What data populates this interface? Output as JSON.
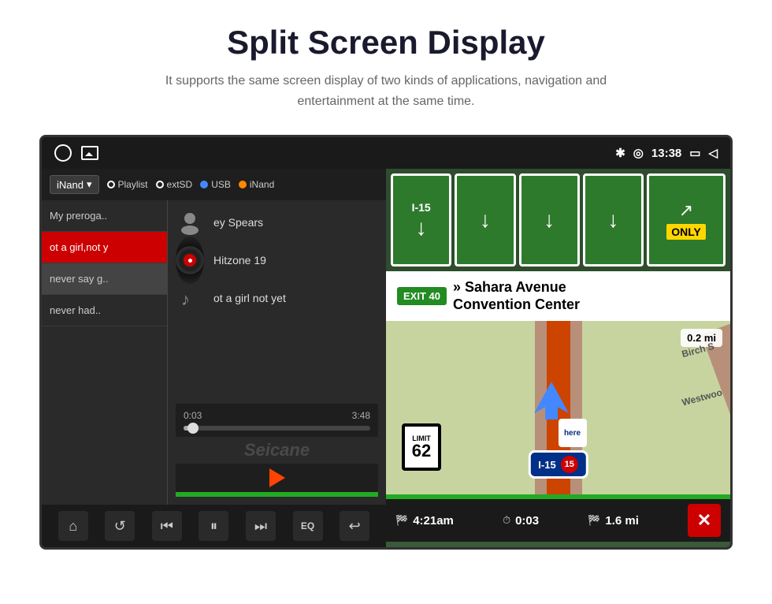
{
  "page": {
    "title": "Split Screen Display",
    "subtitle": "It supports the same screen display of two kinds of applications,\nnavigation and entertainment at the same time."
  },
  "status_bar": {
    "time": "13:38",
    "bluetooth": "✱",
    "location": "◎"
  },
  "music": {
    "source_label": "iNand",
    "sources": [
      "Playlist",
      "extSD",
      "USB",
      "iNand"
    ],
    "playlist": [
      {
        "label": "My preroga..",
        "active": false,
        "selected": false
      },
      {
        "label": "ot a girl,not y",
        "active": true,
        "selected": false
      },
      {
        "label": "never say g..",
        "active": false,
        "selected": true
      },
      {
        "label": "never had..",
        "active": false,
        "selected": false
      }
    ],
    "track_artist": "ey Spears",
    "track_album": "Hitzone 19",
    "track_title": "ot a girl not yet",
    "progress_current": "0:03",
    "progress_total": "3:48",
    "controls": {
      "home": "⌂",
      "repeat": "↺",
      "prev": "⏮",
      "play_pause": "⏸",
      "next": "⏭",
      "eq": "EQ",
      "back": "↩"
    }
  },
  "navigation": {
    "exit_number": "EXIT 40",
    "destination_line1": "» Sahara Avenue",
    "destination_line2": "Convention Center",
    "interstate": "I-15",
    "interstate_num": "15",
    "speed_label": "LIMIT",
    "speed_value": "62",
    "distance": "0.2 mi",
    "eta_time": "4:21am",
    "eta_travel": "0:03",
    "eta_distance": "1.6 mi",
    "road_labels": [
      "Birch S",
      "Westwoo"
    ]
  }
}
